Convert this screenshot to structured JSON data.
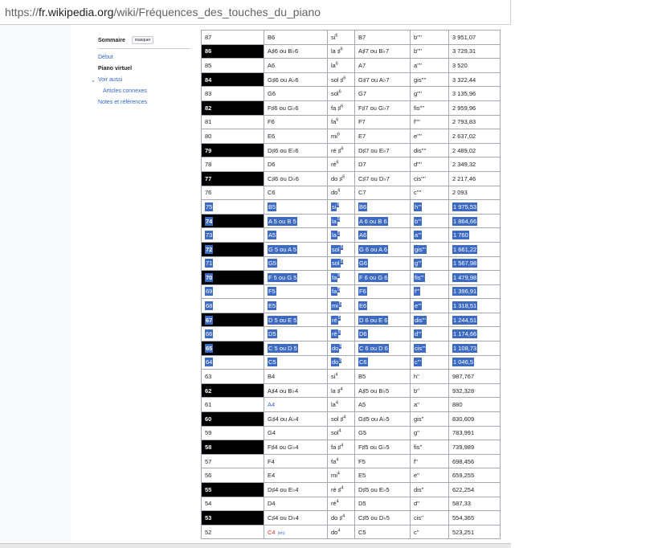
{
  "address_bar": {
    "prefix": "https://",
    "domain": "fr.wikipedia.org",
    "path": "/wiki/Fréquences_des_touches_du_piano"
  },
  "toc": {
    "title": "Sommaire",
    "hide_label": "masquer",
    "items": [
      {
        "label": "Début",
        "active": false,
        "sub": false,
        "chevron": false
      },
      {
        "label": "Piano virtuel",
        "active": true,
        "sub": false,
        "chevron": false
      },
      {
        "label": "Voir aussi",
        "active": false,
        "sub": false,
        "chevron": true
      },
      {
        "label": "Articles connexes",
        "active": false,
        "sub": true,
        "chevron": false
      },
      {
        "label": "Notes et références",
        "active": false,
        "sub": false,
        "chevron": false
      }
    ]
  },
  "table": {
    "rows": [
      {
        "num": "87",
        "black": false,
        "en": "B6",
        "fr": "si",
        "oct": "6",
        "next": "B7",
        "helm": "b''''",
        "freq": "3 951,07",
        "selected": false
      },
      {
        "num": "86",
        "black": true,
        "en": "A♯6 ou B♭6",
        "fr": "la ♯",
        "oct": "6",
        "next": "A♯7 ou B♭7",
        "helm": "b''''",
        "freq": "3 729,31",
        "selected": false
      },
      {
        "num": "85",
        "black": false,
        "en": "A6",
        "fr": "la",
        "oct": "6",
        "next": "A7",
        "helm": "a''''",
        "freq": "3 520",
        "selected": false
      },
      {
        "num": "84",
        "black": true,
        "en": "G♯6 ou A♭6",
        "fr": "sol ♯",
        "oct": "6",
        "next": "G♯7 ou A♭7",
        "helm": "gis''''",
        "freq": "3 322,44",
        "selected": false
      },
      {
        "num": "83",
        "black": false,
        "en": "G6",
        "fr": "sol",
        "oct": "6",
        "next": "G7",
        "helm": "g''''",
        "freq": "3 135,96",
        "selected": false
      },
      {
        "num": "82",
        "black": true,
        "en": "F♯6 ou G♭6",
        "fr": "fa ♯",
        "oct": "6",
        "next": "F♯7 ou G♭7",
        "helm": "fis''''",
        "freq": "2 959,96",
        "selected": false
      },
      {
        "num": "81",
        "black": false,
        "en": "F6",
        "fr": "fa",
        "oct": "6",
        "next": "F7",
        "helm": "f''''",
        "freq": "2 793,83",
        "selected": false
      },
      {
        "num": "80",
        "black": false,
        "en": "E6",
        "fr": "mi",
        "oct": "6",
        "next": "E7",
        "helm": "e''''",
        "freq": "2 637,02",
        "selected": false
      },
      {
        "num": "79",
        "black": true,
        "en": "D♯6 ou E♭6",
        "fr": "ré ♯",
        "oct": "6",
        "next": "D♯7 ou E♭7",
        "helm": "dis''''",
        "freq": "2 489,02",
        "selected": false
      },
      {
        "num": "78",
        "black": false,
        "en": "D6",
        "fr": "ré",
        "oct": "6",
        "next": "D7",
        "helm": "d''''",
        "freq": "2 349,32",
        "selected": false
      },
      {
        "num": "77",
        "black": true,
        "en": "C♯6 ou D♭6",
        "fr": "do ♯",
        "oct": "6",
        "next": "C♯7 ou D♭7",
        "helm": "cis''''",
        "freq": "2 217,46",
        "selected": false
      },
      {
        "num": "76",
        "black": false,
        "en": "C6",
        "fr": "do",
        "oct": "6",
        "next": "C7",
        "helm": "c''''",
        "freq": "2 093",
        "selected": false
      },
      {
        "num": "75",
        "black": false,
        "en": "B5",
        "fr": "si",
        "oct": "5",
        "next": "B6",
        "helm": "h'''",
        "freq": "1 975,53",
        "selected": true
      },
      {
        "num": "74",
        "black": true,
        "en": "A 5 ou B 5",
        "fr": "la",
        "oct": "5",
        "next": "A 6 ou B 6",
        "helm": "b'''",
        "freq": "1 864,66",
        "selected": true
      },
      {
        "num": "73",
        "black": false,
        "en": "A5",
        "fr": "la",
        "oct": "5",
        "next": "A6",
        "helm": "a'''",
        "freq": "1 760",
        "selected": true
      },
      {
        "num": "72",
        "black": true,
        "en": "G 5 ou A 5",
        "fr": "sol",
        "oct": "5",
        "next": "G 6 ou A 6",
        "helm": "gis'''",
        "freq": "1 661,22",
        "selected": true
      },
      {
        "num": "71",
        "black": false,
        "en": "G5",
        "fr": "sol",
        "oct": "5",
        "next": "G6",
        "helm": "g'''",
        "freq": "1 567,98",
        "selected": true
      },
      {
        "num": "70",
        "black": true,
        "en": "F 5 ou G 5",
        "fr": "fa",
        "oct": "5",
        "next": "F 6 ou G 6",
        "helm": "fis'''",
        "freq": "1 479,98",
        "selected": true
      },
      {
        "num": "69",
        "black": false,
        "en": "F5",
        "fr": "fa",
        "oct": "5",
        "next": "F6",
        "helm": "f'''",
        "freq": "1 396,91",
        "selected": true
      },
      {
        "num": "68",
        "black": false,
        "en": "E5",
        "fr": "mi",
        "oct": "5",
        "next": "E6",
        "helm": "e'''",
        "freq": "1 318,51",
        "selected": true
      },
      {
        "num": "67",
        "black": true,
        "en": "D 5 ou E 5",
        "fr": "ré",
        "oct": "5",
        "next": "D 6 ou E 6",
        "helm": "dis'''",
        "freq": "1 244,51",
        "selected": true
      },
      {
        "num": "66",
        "black": false,
        "en": "D5",
        "fr": "ré",
        "oct": "5",
        "next": "D6",
        "helm": "d'''",
        "freq": "1 174,66",
        "selected": true
      },
      {
        "num": "65",
        "black": true,
        "en": "C 5 ou D 5",
        "fr": "do",
        "oct": "5",
        "next": "C 6 ou D 6",
        "helm": "cis'''",
        "freq": "1 108,73",
        "selected": true
      },
      {
        "num": "64",
        "black": false,
        "en": "C5",
        "fr": "do",
        "oct": "5",
        "next": "C6",
        "helm": "c'''",
        "freq": "1 046,5",
        "selected": true
      },
      {
        "num": "63",
        "black": false,
        "en": "B4",
        "fr": "si",
        "oct": "4",
        "next": "B5",
        "helm": "h''",
        "freq": "987,767",
        "selected": false
      },
      {
        "num": "62",
        "black": true,
        "en": "A♯4 ou B♭4",
        "fr": "la ♯",
        "oct": "4",
        "next": "A♯5 ou B♭5",
        "helm": "b''",
        "freq": "932,328",
        "selected": false
      },
      {
        "num": "61",
        "black": false,
        "en": "A4",
        "fr": "la",
        "oct": "4",
        "next": "A5",
        "helm": "a''",
        "freq": "880",
        "selected": false,
        "en_link": "blue"
      },
      {
        "num": "60",
        "black": true,
        "en": "G♯4 ou A♭4",
        "fr": "sol ♯",
        "oct": "4",
        "next": "G♯5 ou A♭5",
        "helm": "gis''",
        "freq": "830,609",
        "selected": false
      },
      {
        "num": "59",
        "black": false,
        "en": "G4",
        "fr": "sol",
        "oct": "4",
        "next": "G5",
        "helm": "g''",
        "freq": "783,991",
        "selected": false
      },
      {
        "num": "58",
        "black": true,
        "en": "F♯4 ou G♭4",
        "fr": "fa ♯",
        "oct": "4",
        "next": "F♯5 ou G♭5",
        "helm": "fis''",
        "freq": "739,989",
        "selected": false
      },
      {
        "num": "57",
        "black": false,
        "en": "F4",
        "fr": "fa",
        "oct": "4",
        "next": "F5",
        "helm": "f''",
        "freq": "698,456",
        "selected": false
      },
      {
        "num": "56",
        "black": false,
        "en": "E4",
        "fr": "mi",
        "oct": "4",
        "next": "E5",
        "helm": "e''",
        "freq": "659,255",
        "selected": false
      },
      {
        "num": "55",
        "black": true,
        "en": "D♯4 ou E♭4",
        "fr": "ré ♯",
        "oct": "4",
        "next": "D♯5 ou E♭5",
        "helm": "dis''",
        "freq": "622,254",
        "selected": false
      },
      {
        "num": "54",
        "black": false,
        "en": "D4",
        "fr": "ré",
        "oct": "4",
        "next": "D5",
        "helm": "d''",
        "freq": "587,33",
        "selected": false
      },
      {
        "num": "53",
        "black": true,
        "en": "C♯4 ou D♭4",
        "fr": "do ♯",
        "oct": "4",
        "next": "C♯5 ou D♭5",
        "helm": "cis''",
        "freq": "554,365",
        "selected": false
      },
      {
        "num": "52",
        "black": false,
        "en": "C4",
        "fr": "do",
        "oct": "4",
        "next": "C5",
        "helm": "c''",
        "freq": "523,251",
        "selected": false,
        "en_link": "red",
        "en_tag": "(en)"
      }
    ]
  },
  "colors": {
    "selection": "#3d6bc4",
    "link": "#3366cc",
    "redlink": "#d73333",
    "black_key": "#000000"
  }
}
